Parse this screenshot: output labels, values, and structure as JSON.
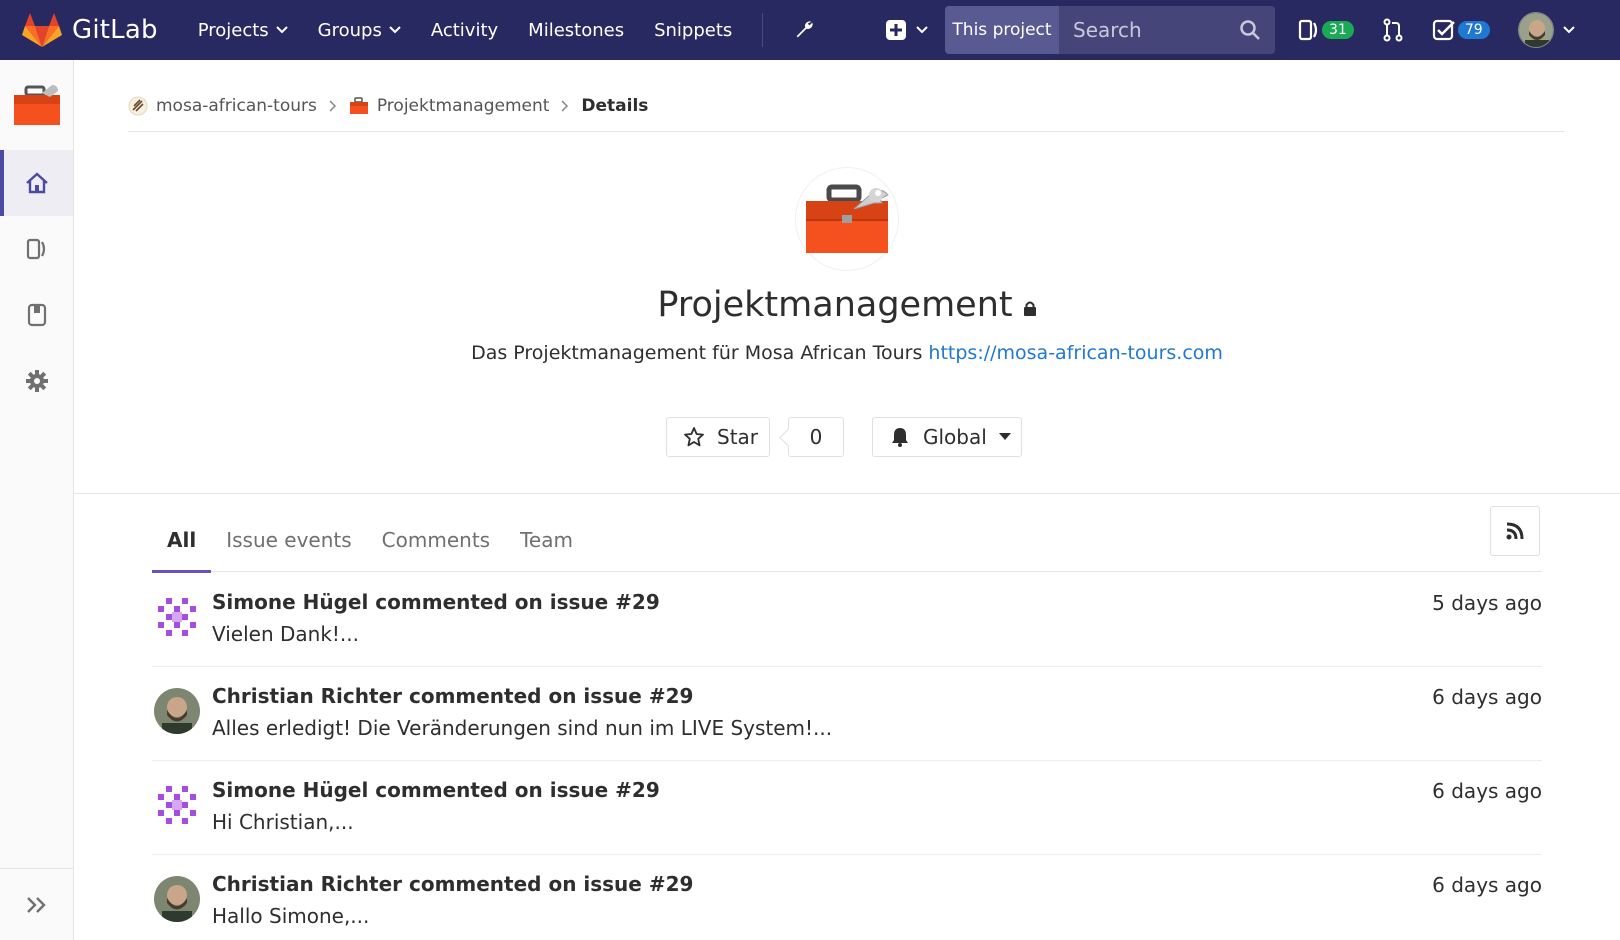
{
  "navbar": {
    "brand": "GitLab",
    "links": [
      {
        "label": "Projects",
        "dropdown": true
      },
      {
        "label": "Groups",
        "dropdown": true
      },
      {
        "label": "Activity",
        "dropdown": false
      },
      {
        "label": "Milestones",
        "dropdown": false
      },
      {
        "label": "Snippets",
        "dropdown": false
      }
    ],
    "search_scope": "This project",
    "search_placeholder": "Search",
    "issues_count": "31",
    "todos_count": "79"
  },
  "breadcrumb": {
    "group": "mosa-african-tours",
    "project": "Projektmanagement",
    "current": "Details"
  },
  "project": {
    "title": "Projektmanagement",
    "description": "Das Projektmanagement für Mosa African Tours",
    "link": "https://mosa-african-tours.com",
    "star_label": "Star",
    "star_count": "0",
    "notification_label": "Global"
  },
  "tabs": [
    {
      "label": "All",
      "active": true
    },
    {
      "label": "Issue events",
      "active": false
    },
    {
      "label": "Comments",
      "active": false
    },
    {
      "label": "Team",
      "active": false
    }
  ],
  "events": [
    {
      "author": "Simone Hügel",
      "action": "commented on issue #29",
      "text": "Vielen Dank!...",
      "time": "5 days ago",
      "avatar": "identicon"
    },
    {
      "author": "Christian Richter",
      "action": "commented on issue #29",
      "text": "Alles erledigt! Die Veränderungen sind nun im LIVE System!...",
      "time": "6 days ago",
      "avatar": "photo"
    },
    {
      "author": "Simone Hügel",
      "action": "commented on issue #29",
      "text": "Hi Christian,...",
      "time": "6 days ago",
      "avatar": "identicon"
    },
    {
      "author": "Christian Richter",
      "action": "commented on issue #29",
      "text": "Hallo Simone,...",
      "time": "6 days ago",
      "avatar": "photo"
    }
  ],
  "colors": {
    "navbar": "#292961",
    "accent": "#6b4fbb",
    "link": "#1f78d1",
    "badge_green": "#1aaa55",
    "badge_blue": "#1f78d1"
  }
}
